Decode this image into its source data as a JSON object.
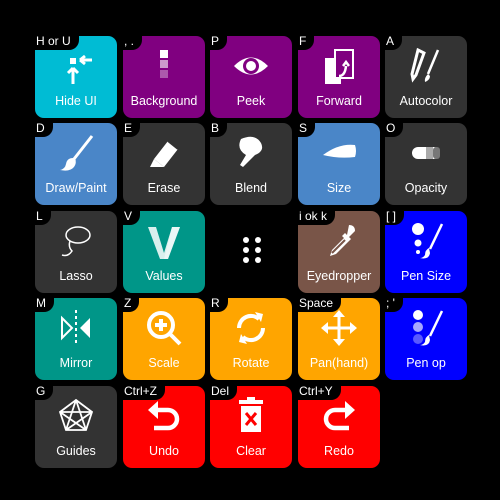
{
  "tiles": [
    {
      "label": "Hide UI",
      "shortcut": "H or U",
      "color": "#00bcd4",
      "icon": "hide-ui-icon"
    },
    {
      "label": "Background",
      "shortcut": ", .",
      "color": "#800080",
      "icon": "background-layers-icon"
    },
    {
      "label": "Peek",
      "shortcut": "P",
      "color": "#800080",
      "icon": "eye-icon"
    },
    {
      "label": "Forward",
      "shortcut": "F",
      "color": "#800080",
      "icon": "forward-page-icon"
    },
    {
      "label": "Autocolor",
      "shortcut": "A",
      "color": "#333333",
      "icon": "autocolor-icon"
    },
    {
      "label": "Draw/Paint",
      "shortcut": "D",
      "color": "#4a86c8",
      "icon": "brush-icon"
    },
    {
      "label": "Erase",
      "shortcut": "E",
      "color": "#333333",
      "icon": "eraser-icon"
    },
    {
      "label": "Blend",
      "shortcut": "B",
      "color": "#333333",
      "icon": "blend-icon"
    },
    {
      "label": "Size",
      "shortcut": "S",
      "color": "#4a86c8",
      "icon": "size-stroke-icon"
    },
    {
      "label": "Opacity",
      "shortcut": "O",
      "color": "#333333",
      "icon": "opacity-icon"
    },
    {
      "label": "Lasso",
      "shortcut": "L",
      "color": "#333333",
      "icon": "lasso-icon"
    },
    {
      "label": "Values",
      "shortcut": "V",
      "color": "#009688",
      "icon": "values-icon"
    },
    {
      "label": "Eyedropper",
      "shortcut": "i ok k",
      "color": "#795548",
      "icon": "eyedropper-icon"
    },
    {
      "label": "Pen Size",
      "shortcut": "[ ]",
      "color": "#0000ff",
      "icon": "pen-size-icon"
    },
    {
      "label": "Mirror",
      "shortcut": "M",
      "color": "#009688",
      "icon": "mirror-icon"
    },
    {
      "label": "Scale",
      "shortcut": "Z",
      "color": "#ffa500",
      "icon": "zoom-icon"
    },
    {
      "label": "Rotate",
      "shortcut": "R",
      "color": "#ffa500",
      "icon": "rotate-icon"
    },
    {
      "label": "Pan(hand)",
      "shortcut": "Space",
      "color": "#ffa500",
      "icon": "move-icon"
    },
    {
      "label": "Pen op",
      "shortcut": "; '",
      "color": "#0000ff",
      "icon": "pen-opacity-icon"
    },
    {
      "label": "Guides",
      "shortcut": "G",
      "color": "#333333",
      "icon": "guides-icon"
    },
    {
      "label": "Undo",
      "shortcut": "Ctrl+Z",
      "color": "#ff0000",
      "icon": "undo-icon"
    },
    {
      "label": "Clear",
      "shortcut": "Del",
      "color": "#ff0000",
      "icon": "trash-icon"
    },
    {
      "label": "Redo",
      "shortcut": "Ctrl+Y",
      "color": "#ff0000",
      "icon": "redo-icon"
    }
  ],
  "drag_handle": "drag-handle-icon"
}
